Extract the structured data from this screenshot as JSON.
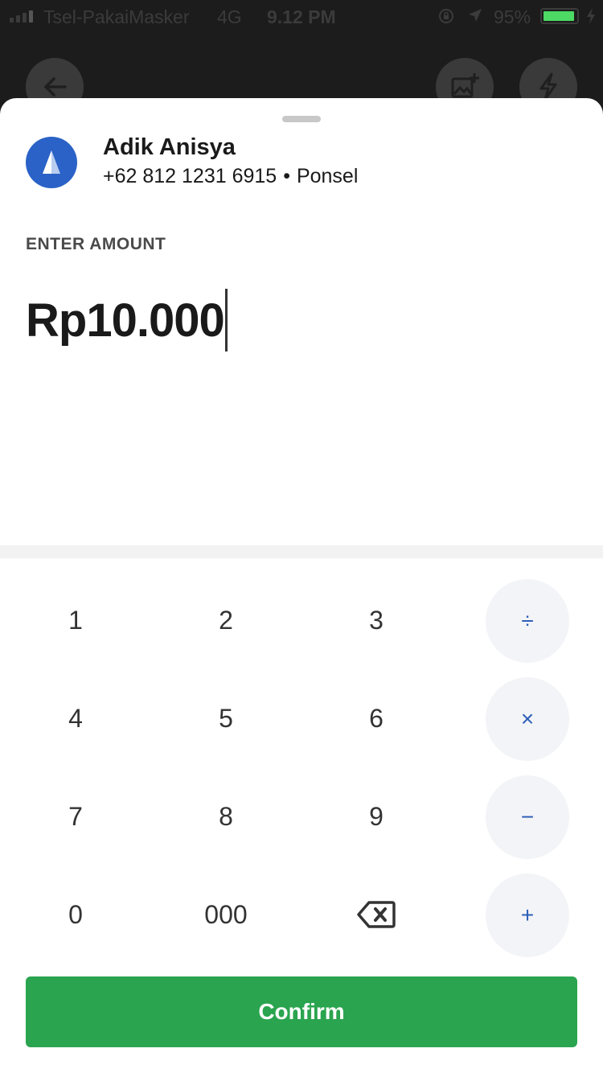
{
  "status_bar": {
    "carrier": "Tsel-PakaiMasker",
    "network": "4G",
    "time": "9.12 PM",
    "battery_percent": "95%",
    "battery_level": 0.95,
    "battery_color": "#4cd964"
  },
  "contact": {
    "name": "Adik Anisya",
    "phone": "+62 812 1231 6915",
    "separator": "•",
    "type": "Ponsel",
    "avatar_color": "#2a62c7"
  },
  "amount": {
    "label": "ENTER AMOUNT",
    "value": "Rp10.000"
  },
  "keypad": {
    "keys": [
      "1",
      "2",
      "3",
      "4",
      "5",
      "6",
      "7",
      "8",
      "9",
      "0",
      "000"
    ],
    "backspace_icon": "backspace-icon",
    "operators": [
      "÷",
      "×",
      "−",
      "+"
    ]
  },
  "actions": {
    "confirm_label": "Confirm",
    "confirm_color": "#2aa44f"
  }
}
